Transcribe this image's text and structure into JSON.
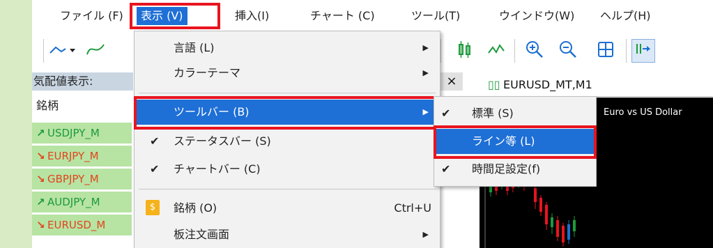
{
  "menubar": {
    "items": [
      "ファイル (F)",
      "表示 (V)",
      "挿入(I)",
      "チャート (C)",
      "ツール(T)",
      "ウインドウ(W)",
      "ヘルプ(H)"
    ]
  },
  "market_watch": {
    "title": "気配値表示:",
    "column_header": "銘柄",
    "rows": [
      {
        "symbol": "USDJPY_M",
        "arrow": "↗"
      },
      {
        "symbol": "EURJPY_M",
        "arrow": "↘"
      },
      {
        "symbol": "GBPJPY_M",
        "arrow": "↘"
      },
      {
        "symbol": "AUDJPY_M",
        "arrow": "↗"
      },
      {
        "symbol": "EURUSD_M",
        "arrow": "↘"
      }
    ]
  },
  "chart_window": {
    "close_label": "×",
    "tab_label": "EURUSD_MT,M1",
    "description": "Euro vs US Dollar"
  },
  "view_menu": {
    "items": [
      {
        "label": "言語 (L)",
        "submenu_arrow": "▶"
      },
      {
        "label": "カラーテーマ",
        "submenu_arrow": "▶"
      },
      {
        "label": "ツールバー (B)",
        "submenu_arrow": "▶"
      },
      {
        "label": "ステータスバー (S)",
        "check": "✔"
      },
      {
        "label": "チャートバー (C)",
        "check": "✔"
      },
      {
        "label": "銘柄 (O)",
        "badge": "$",
        "shortcut": "Ctrl+U"
      },
      {
        "label": "板注文画面",
        "submenu_arrow": "▶"
      }
    ]
  },
  "toolbar_submenu": {
    "items": [
      {
        "label": "標準 (S)",
        "check": "✔"
      },
      {
        "label": "ライン等 (L)"
      },
      {
        "label": "時間足設定(f)",
        "check": "✔"
      }
    ]
  },
  "colors": {
    "highlight": "#1e6fd6",
    "callout_red": "#e8141f",
    "up_green": "#1c9a3c",
    "down_red": "#e0461e",
    "row_green": "#b7e3a3"
  }
}
